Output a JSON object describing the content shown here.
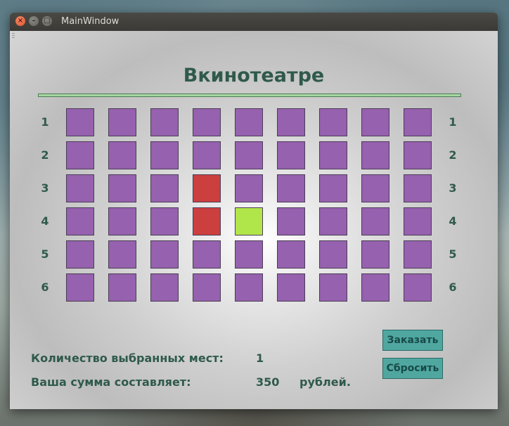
{
  "window": {
    "title": "MainWindow",
    "close_glyph": "×",
    "min_glyph": "–",
    "max_glyph": "□"
  },
  "header": {
    "title": "Вкинотеатре"
  },
  "hall": {
    "rows": [
      "1",
      "2",
      "3",
      "4",
      "5",
      "6"
    ],
    "seats_per_row": 9,
    "seat_states": [
      [
        "free",
        "free",
        "free",
        "free",
        "free",
        "free",
        "free",
        "free",
        "free"
      ],
      [
        "free",
        "free",
        "free",
        "free",
        "free",
        "free",
        "free",
        "free",
        "free"
      ],
      [
        "free",
        "free",
        "free",
        "taken",
        "free",
        "free",
        "free",
        "free",
        "free"
      ],
      [
        "free",
        "free",
        "free",
        "taken",
        "selected",
        "free",
        "free",
        "free",
        "free"
      ],
      [
        "free",
        "free",
        "free",
        "free",
        "free",
        "free",
        "free",
        "free",
        "free"
      ],
      [
        "free",
        "free",
        "free",
        "free",
        "free",
        "free",
        "free",
        "free",
        "free"
      ]
    ],
    "colors": {
      "free": "#9661ae",
      "taken": "#cc3f3f",
      "selected": "#b1e64a"
    }
  },
  "summary": {
    "count_label": "Количество выбранных мест:",
    "count_value": "1",
    "sum_label": "Ваша сумма составляет:",
    "sum_value": "350",
    "currency": "рублей."
  },
  "actions": {
    "order_label": "Заказать",
    "reset_label": "Сбросить"
  },
  "colors": {
    "text": "#2f5a4b",
    "button": "#4fa7a0",
    "rule": "#a6d7a2"
  }
}
